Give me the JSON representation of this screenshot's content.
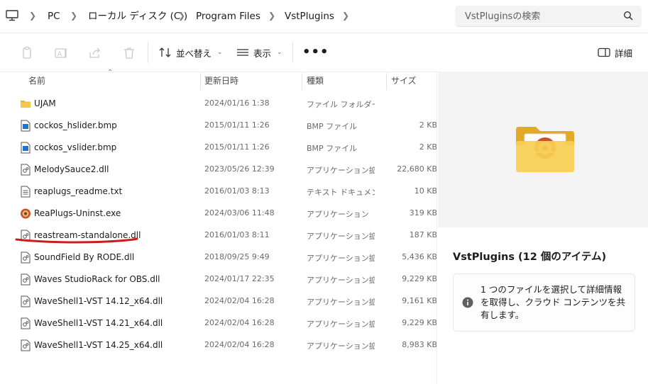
{
  "address": {
    "breadcrumbs": [
      "PC",
      "ローカル ディスク (C:)",
      "Program Files",
      "VstPlugins"
    ],
    "search_placeholder": "VstPluginsの検索",
    "icons": [
      "monitor-icon",
      "chevron-right-icon",
      "search-icon"
    ]
  },
  "toolbar": {
    "sort_label": "並べ替え",
    "view_label": "表示",
    "more_label": "•••",
    "details_label": "詳細",
    "icons": [
      "copy-icon",
      "rename-icon",
      "share-icon",
      "delete-icon",
      "sort-icon",
      "view-icon",
      "details-pane-icon"
    ]
  },
  "columns": {
    "name": "名前",
    "date": "更新日時",
    "type": "種類",
    "size": "サイズ"
  },
  "files": [
    {
      "name": "UJAM",
      "date": "2024/01/16 1:38",
      "type": "ファイル フォルダー",
      "size": "",
      "icon": "folder-icon"
    },
    {
      "name": "cockos_hslider.bmp",
      "date": "2015/01/11 1:26",
      "type": "BMP ファイル",
      "size": "2 KB",
      "icon": "image-file-icon"
    },
    {
      "name": "cockos_vslider.bmp",
      "date": "2015/01/11 1:26",
      "type": "BMP ファイル",
      "size": "2 KB",
      "icon": "image-file-icon"
    },
    {
      "name": "MelodySauce2.dll",
      "date": "2023/05/26 12:39",
      "type": "アプリケーション拡張",
      "size": "22,680 KB",
      "icon": "dll-file-icon"
    },
    {
      "name": "reaplugs_readme.txt",
      "date": "2016/01/03 8:13",
      "type": "テキスト ドキュメント",
      "size": "10 KB",
      "icon": "text-file-icon"
    },
    {
      "name": "ReaPlugs-Uninst.exe",
      "date": "2024/03/06 11:48",
      "type": "アプリケーション",
      "size": "319 KB",
      "icon": "app-exe-icon"
    },
    {
      "name": "reastream-standalone.dll",
      "date": "2016/01/03 8:11",
      "type": "アプリケーション拡張",
      "size": "187 KB",
      "icon": "dll-file-icon"
    },
    {
      "name": "SoundField By RODE.dll",
      "date": "2018/09/25 9:49",
      "type": "アプリケーション拡張",
      "size": "5,436 KB",
      "icon": "dll-file-icon"
    },
    {
      "name": "Waves StudioRack for OBS.dll",
      "date": "2024/01/17 22:35",
      "type": "アプリケーション拡張",
      "size": "9,229 KB",
      "icon": "dll-file-icon"
    },
    {
      "name": "WaveShell1-VST 14.12_x64.dll",
      "date": "2024/02/04 16:28",
      "type": "アプリケーション拡張",
      "size": "9,161 KB",
      "icon": "dll-file-icon"
    },
    {
      "name": "WaveShell1-VST 14.21_x64.dll",
      "date": "2024/02/04 16:28",
      "type": "アプリケーション拡張",
      "size": "9,229 KB",
      "icon": "dll-file-icon"
    },
    {
      "name": "WaveShell1-VST 14.25_x64.dll",
      "date": "2024/02/04 16:28",
      "type": "アプリケーション拡張",
      "size": "8,983 KB",
      "icon": "dll-file-icon"
    }
  ],
  "detail_pane": {
    "title": "VstPlugins (12 個のアイテム)",
    "info": "1 つのファイルを選択して詳細情報を取得し、クラウド コンテンツを共有します。",
    "icons": [
      "large-folder-icon",
      "info-icon"
    ]
  },
  "annotation": {
    "color": "#cc1d1d",
    "highlighted_file": "reastream-standalone.dll"
  },
  "colors": {
    "folder": "#f4c542",
    "accent": "#0067c0",
    "toolbar_icon": "#c8c8c8"
  }
}
